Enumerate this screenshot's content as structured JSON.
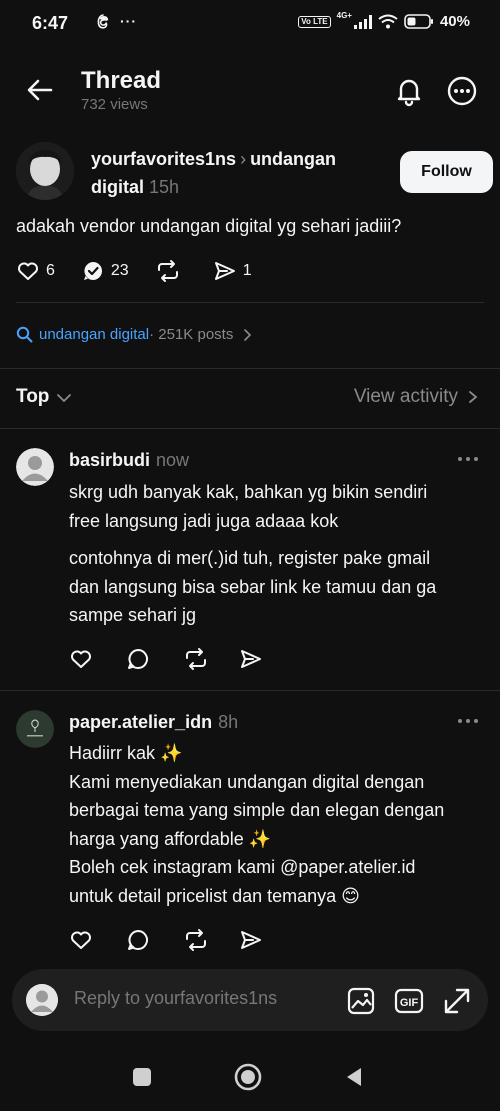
{
  "status_bar": {
    "time": "6:47",
    "volte": "Vo LTE",
    "network": "4G+",
    "battery": "40%"
  },
  "header": {
    "title": "Thread",
    "views": "732 views"
  },
  "post": {
    "username": "yourfavorites1ns",
    "separator": "›",
    "topic": "undangan digital",
    "time": "15h",
    "follow_label": "Follow",
    "text": "adakah vendor undangan digital yg sehari jadiii?",
    "likes": "6",
    "comments": "23",
    "shares": "1"
  },
  "topic_row": {
    "name": "undangan digital",
    "count": " · 251K posts"
  },
  "sort": {
    "label": "Top",
    "view_activity": "View activity"
  },
  "replies": [
    {
      "username": "basirbudi",
      "time": "now",
      "paragraph1": "skrg udh banyak kak, bahkan yg bikin sendiri\nfree langsung jadi juga adaaa kok",
      "paragraph2": "contohnya di mer(.)id tuh, register pake gmail\ndan langsung bisa sebar link ke tamuu dan ga\nsampe sehari jg"
    },
    {
      "username": "paper.atelier_idn",
      "time": "8h",
      "body": "Hadiirr kak ✨\nKami menyediakan undangan digital dengan\nberbagai tema yang simple dan elegan dengan\nharga yang affordable ✨\nBoleh cek instagram kami @paper.atelier.id\nuntuk detail pricelist dan temanya 😊"
    }
  ],
  "composer": {
    "placeholder": "Reply to yourfavorites1ns"
  },
  "colors": {
    "background": "#101010",
    "text": "#f3f5f7",
    "muted": "#777777",
    "link": "#4aa3ff"
  }
}
